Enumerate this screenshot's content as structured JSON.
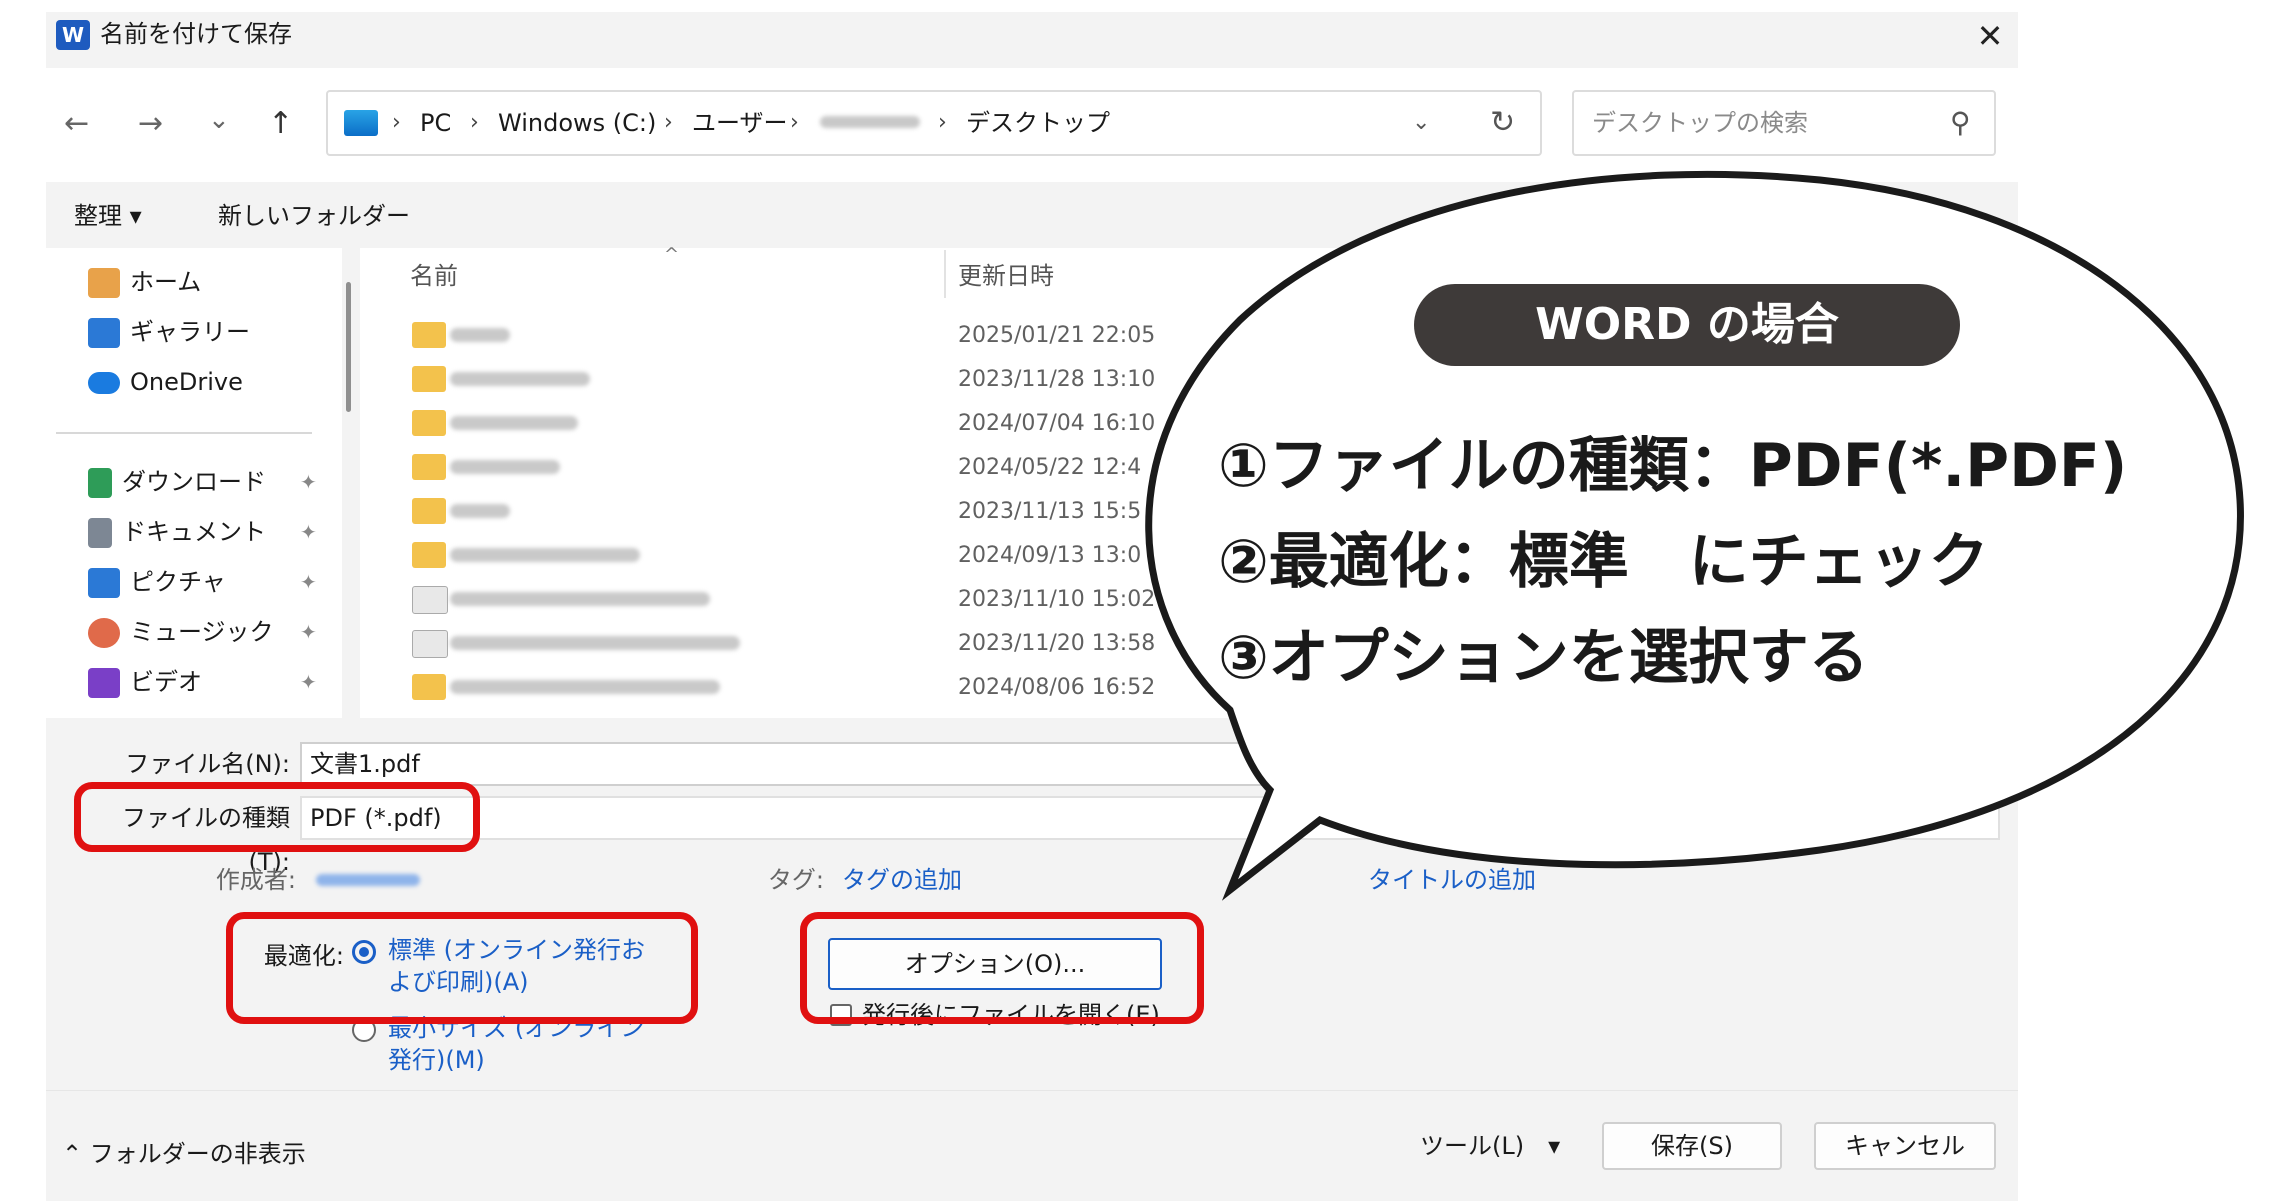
{
  "dialog": {
    "title": "名前を付けて保存",
    "app_icon": "word-icon",
    "close_glyph": "✕"
  },
  "nav": {
    "back": "←",
    "forward": "→",
    "recent": "⌄",
    "up": "↑",
    "breadcrumb": [
      "PC",
      "Windows (C:)",
      "ユーザー",
      "デスクトップ"
    ],
    "refresh": "↻",
    "search_placeholder": "デスクトップの検索"
  },
  "toolbar": {
    "organize": "整理 ▾",
    "new_folder": "新しいフォルダー"
  },
  "sidebar": {
    "items": [
      {
        "label": "ホーム",
        "icon": "home-icon",
        "pinned": false
      },
      {
        "label": "ギャラリー",
        "icon": "gallery-icon",
        "pinned": false
      },
      {
        "label": "OneDrive",
        "icon": "cloud-icon",
        "pinned": false
      },
      {
        "label": "ダウンロード",
        "icon": "download-icon",
        "pinned": true
      },
      {
        "label": "ドキュメント",
        "icon": "document-icon",
        "pinned": true
      },
      {
        "label": "ピクチャ",
        "icon": "picture-icon",
        "pinned": true
      },
      {
        "label": "ミュージック",
        "icon": "music-icon",
        "pinned": true
      },
      {
        "label": "ビデオ",
        "icon": "video-icon",
        "pinned": true
      }
    ],
    "pin_glyph": "📌"
  },
  "filelist": {
    "col_name": "名前",
    "col_date": "更新日時",
    "dates": [
      "2025/01/21 22:05",
      "2023/11/28 13:10",
      "2024/07/04 16:10",
      "2024/05/22 12:4",
      "2023/11/13 15:5",
      "2024/09/13 13:0",
      "2023/11/10 15:02",
      "2023/11/20 13:58",
      "2024/08/06 16:52"
    ]
  },
  "fields": {
    "filename_label": "ファイル名(N):",
    "filename_value": "文書1.pdf",
    "filetype_label": "ファイルの種類(T):",
    "filetype_value": "PDF (*.pdf)",
    "author_label": "作成者:",
    "tag_label": "タグ:",
    "tag_link": "タグの追加",
    "title_link": "タイトルの追加",
    "optimize_label": "最適化:",
    "opt_standard": "標準 (オンライン発行および印刷)(A)",
    "opt_min": "最小サイズ (オンライン発行)(M)",
    "options_button": "オプション(O)...",
    "open_after": "発行後にファイルを開く(E)"
  },
  "footer": {
    "hide_folders": "フォルダーの非表示",
    "tools": "ツール(L)",
    "save": "保存(S)",
    "cancel": "キャンセル"
  },
  "callout": {
    "heading": "WORD の場合",
    "lines": [
      "①ファイルの種類：PDF(*.PDF)",
      "②最適化：標準　にチェック",
      "③オプションを選択する"
    ]
  },
  "colors": {
    "accent": "#1a5fc7",
    "highlight": "#e01010",
    "pill": "#3e3a39"
  }
}
